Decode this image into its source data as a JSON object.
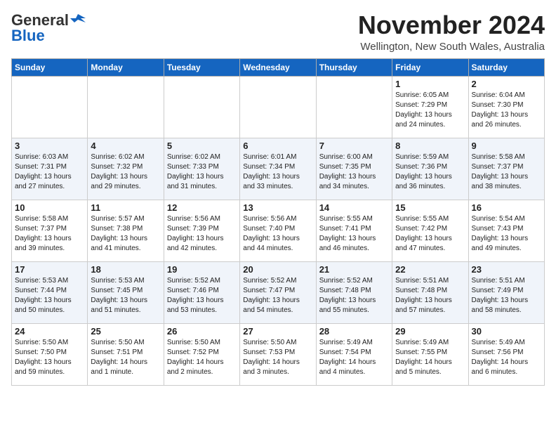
{
  "logo": {
    "general": "General",
    "blue": "Blue"
  },
  "header": {
    "month_title": "November 2024",
    "location": "Wellington, New South Wales, Australia"
  },
  "calendar": {
    "days_of_week": [
      "Sunday",
      "Monday",
      "Tuesday",
      "Wednesday",
      "Thursday",
      "Friday",
      "Saturday"
    ],
    "weeks": [
      [
        {
          "day": "",
          "info": ""
        },
        {
          "day": "",
          "info": ""
        },
        {
          "day": "",
          "info": ""
        },
        {
          "day": "",
          "info": ""
        },
        {
          "day": "",
          "info": ""
        },
        {
          "day": "1",
          "info": "Sunrise: 6:05 AM\nSunset: 7:29 PM\nDaylight: 13 hours\nand 24 minutes."
        },
        {
          "day": "2",
          "info": "Sunrise: 6:04 AM\nSunset: 7:30 PM\nDaylight: 13 hours\nand 26 minutes."
        }
      ],
      [
        {
          "day": "3",
          "info": "Sunrise: 6:03 AM\nSunset: 7:31 PM\nDaylight: 13 hours\nand 27 minutes."
        },
        {
          "day": "4",
          "info": "Sunrise: 6:02 AM\nSunset: 7:32 PM\nDaylight: 13 hours\nand 29 minutes."
        },
        {
          "day": "5",
          "info": "Sunrise: 6:02 AM\nSunset: 7:33 PM\nDaylight: 13 hours\nand 31 minutes."
        },
        {
          "day": "6",
          "info": "Sunrise: 6:01 AM\nSunset: 7:34 PM\nDaylight: 13 hours\nand 33 minutes."
        },
        {
          "day": "7",
          "info": "Sunrise: 6:00 AM\nSunset: 7:35 PM\nDaylight: 13 hours\nand 34 minutes."
        },
        {
          "day": "8",
          "info": "Sunrise: 5:59 AM\nSunset: 7:36 PM\nDaylight: 13 hours\nand 36 minutes."
        },
        {
          "day": "9",
          "info": "Sunrise: 5:58 AM\nSunset: 7:37 PM\nDaylight: 13 hours\nand 38 minutes."
        }
      ],
      [
        {
          "day": "10",
          "info": "Sunrise: 5:58 AM\nSunset: 7:37 PM\nDaylight: 13 hours\nand 39 minutes."
        },
        {
          "day": "11",
          "info": "Sunrise: 5:57 AM\nSunset: 7:38 PM\nDaylight: 13 hours\nand 41 minutes."
        },
        {
          "day": "12",
          "info": "Sunrise: 5:56 AM\nSunset: 7:39 PM\nDaylight: 13 hours\nand 42 minutes."
        },
        {
          "day": "13",
          "info": "Sunrise: 5:56 AM\nSunset: 7:40 PM\nDaylight: 13 hours\nand 44 minutes."
        },
        {
          "day": "14",
          "info": "Sunrise: 5:55 AM\nSunset: 7:41 PM\nDaylight: 13 hours\nand 46 minutes."
        },
        {
          "day": "15",
          "info": "Sunrise: 5:55 AM\nSunset: 7:42 PM\nDaylight: 13 hours\nand 47 minutes."
        },
        {
          "day": "16",
          "info": "Sunrise: 5:54 AM\nSunset: 7:43 PM\nDaylight: 13 hours\nand 49 minutes."
        }
      ],
      [
        {
          "day": "17",
          "info": "Sunrise: 5:53 AM\nSunset: 7:44 PM\nDaylight: 13 hours\nand 50 minutes."
        },
        {
          "day": "18",
          "info": "Sunrise: 5:53 AM\nSunset: 7:45 PM\nDaylight: 13 hours\nand 51 minutes."
        },
        {
          "day": "19",
          "info": "Sunrise: 5:52 AM\nSunset: 7:46 PM\nDaylight: 13 hours\nand 53 minutes."
        },
        {
          "day": "20",
          "info": "Sunrise: 5:52 AM\nSunset: 7:47 PM\nDaylight: 13 hours\nand 54 minutes."
        },
        {
          "day": "21",
          "info": "Sunrise: 5:52 AM\nSunset: 7:48 PM\nDaylight: 13 hours\nand 55 minutes."
        },
        {
          "day": "22",
          "info": "Sunrise: 5:51 AM\nSunset: 7:48 PM\nDaylight: 13 hours\nand 57 minutes."
        },
        {
          "day": "23",
          "info": "Sunrise: 5:51 AM\nSunset: 7:49 PM\nDaylight: 13 hours\nand 58 minutes."
        }
      ],
      [
        {
          "day": "24",
          "info": "Sunrise: 5:50 AM\nSunset: 7:50 PM\nDaylight: 13 hours\nand 59 minutes."
        },
        {
          "day": "25",
          "info": "Sunrise: 5:50 AM\nSunset: 7:51 PM\nDaylight: 14 hours\nand 1 minute."
        },
        {
          "day": "26",
          "info": "Sunrise: 5:50 AM\nSunset: 7:52 PM\nDaylight: 14 hours\nand 2 minutes."
        },
        {
          "day": "27",
          "info": "Sunrise: 5:50 AM\nSunset: 7:53 PM\nDaylight: 14 hours\nand 3 minutes."
        },
        {
          "day": "28",
          "info": "Sunrise: 5:49 AM\nSunset: 7:54 PM\nDaylight: 14 hours\nand 4 minutes."
        },
        {
          "day": "29",
          "info": "Sunrise: 5:49 AM\nSunset: 7:55 PM\nDaylight: 14 hours\nand 5 minutes."
        },
        {
          "day": "30",
          "info": "Sunrise: 5:49 AM\nSunset: 7:56 PM\nDaylight: 14 hours\nand 6 minutes."
        }
      ]
    ]
  }
}
